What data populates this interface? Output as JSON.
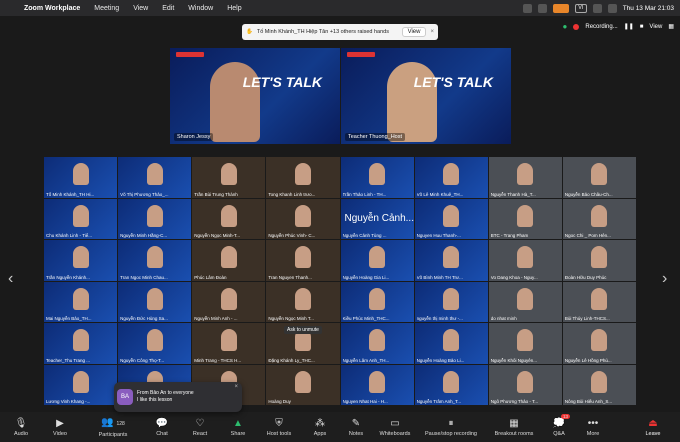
{
  "menubar": {
    "app_name": "Zoom Workplace",
    "items": [
      "Meeting",
      "View",
      "Edit",
      "Window",
      "Help"
    ],
    "datetime": "Thu 13 Mar  21:03"
  },
  "banner": {
    "text": "Tố Minh Khánh_TH Hiệp Tân +13 others raised hands",
    "view_label": "View",
    "close": "×"
  },
  "topright": {
    "recording": "Recording...",
    "view": "View"
  },
  "speakers": [
    {
      "name": "Sharon Jessy",
      "tagline": "LET'S TALK"
    },
    {
      "name": "Teacher Thuong_Host",
      "tagline": "LET'S TALK"
    }
  ],
  "tiles": [
    "Tố Minh Khánh_TH Hi...",
    "Võ Thị Phương Thảo_...",
    "Trần Bùi Trung Thành",
    "Tong Khanh Linh trưo...",
    "Trần Thảo Linh - TH...",
    "Võ Lê Minh Khuê_TH...",
    "Nguyễn Thanh Hà_T...",
    "Nguyễn Bảo Châu-Ch...",
    "Chu Khánh Linh - Tiể...",
    "Nguyễn Minh Hằng-C...",
    "Nguyễn Ngọc Minh-T...",
    "Nguyễn Phúc Vinh- C...",
    "Nguyễn Cảnh Tùng ...",
    "Nguyen Huu Thanh-...",
    "BTC - Trang Pham",
    "Ngoc Chi _ Pom Hên...",
    "Trần Nguyễn Khánh...",
    "Tran Ngoc Minh Chau...",
    "Phúc Lâm Đoàn",
    "Tran Nguyen Thanh...",
    "Nguyễn Hoàng Gia Li...",
    "Võ Bình Minh TH Trư...",
    "Vo Dang Khoa - Nguy...",
    "Đoàn Hữu Duy Phúc",
    "Mai Nguyễn Bảo_TH...",
    "Nguyễn Đức Hùng Sa...",
    "Nguyễn Minh Anh - ...",
    "Nguyễn Ngọc Minh T...",
    "Kiều Phúc Minh_THC...",
    "nguyễn thị minh thư -...",
    "do nhat minh",
    "Bùi Thúy Linh-THCS...",
    "Teacher_Thu Trang ...",
    "Nguyễn Công Thọ-T...",
    "Minh Trang - THCS H...",
    "Đặng Khánh Ly_THC...",
    "Nguyễn Lâm Anh_TH...",
    "Nguyễn Hoàng Bảo Li...",
    "Nguyễn Khôi Nguyên...",
    "Nguyễn Lê Hồng Phú...",
    "Lương Vinh Khang -...",
    "",
    "",
    "Hoàng Duy",
    "Nguyen Nhat Hai - H...",
    "Nguyễn Trâm Anh_T...",
    "Ngô Phương Thảo - T...",
    "Nông Bùi Hiếu Anh_S..."
  ],
  "big_tile_text": "Nguyễn Cảnh...",
  "ask_unmute": "Ask to unmute",
  "chat": {
    "avatar": "BA",
    "line1": "From Bảo An to everyone",
    "line2": "I like this lesson",
    "close": "×"
  },
  "toolbar": {
    "audio": "Audio",
    "video": "Video",
    "participants": "Participants",
    "participants_count": "128",
    "chat": "Chat",
    "react": "React",
    "share": "Share",
    "host_tools": "Host tools",
    "apps": "Apps",
    "notes": "Notes",
    "whiteboards": "Whiteboards",
    "pause_recording": "Pause/stop recording",
    "breakout": "Breakout rooms",
    "qa": "Q&A",
    "qa_badge": "13",
    "more": "More",
    "leave": "Leave"
  }
}
